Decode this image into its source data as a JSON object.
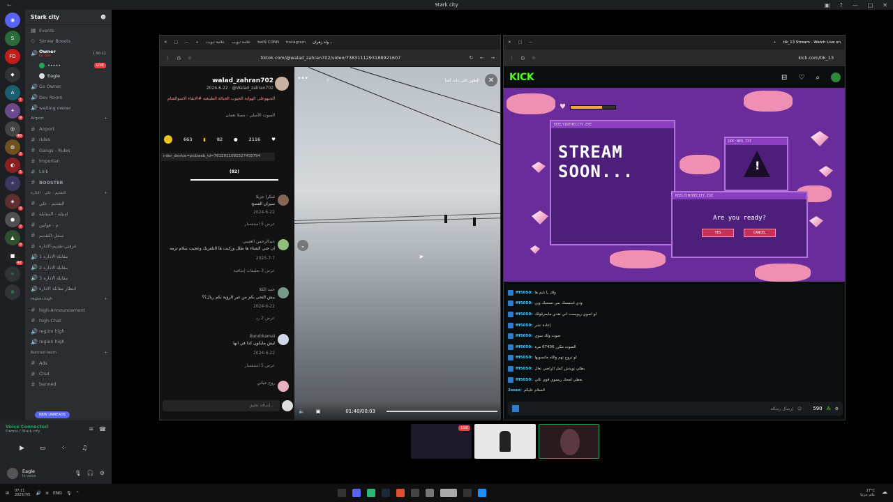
{
  "app": {
    "title": "Stark city"
  },
  "server": {
    "name": "Stark city"
  },
  "channels": {
    "top": [
      {
        "label": "Events"
      },
      {
        "label": "Server Boosts"
      }
    ],
    "owner_voice": {
      "label": "Owner",
      "sublabel": "Go Live",
      "timer": "1:50:11"
    },
    "owner_users": [
      {
        "name": "•••••",
        "live": "LIVE"
      },
      {
        "name": "Eagle",
        "live": ""
      }
    ],
    "items": [
      {
        "label": "Co Owner"
      },
      {
        "label": "Dev Room"
      },
      {
        "label": "waiting owner"
      }
    ],
    "cat_airport": "Airport",
    "airport": [
      {
        "label": "Airport"
      },
      {
        "label": "rules"
      },
      {
        "label": "Gangs - Rules"
      },
      {
        "label": "Importan"
      },
      {
        "label": "Link"
      },
      {
        "label": "BOOSTER"
      }
    ],
    "cat_arabic": "التقديم - علي - الادارة",
    "arabic": [
      {
        "label": "التقديم - علي"
      },
      {
        "label": "اسئلة - المقابلة"
      },
      {
        "label": "م - قوانين"
      },
      {
        "label": "سجل-التقديم"
      },
      {
        "label": "غرفتي-تقديم-الاداره"
      },
      {
        "label": "مقابلة-الاداره 1"
      },
      {
        "label": "مقابلة الاداره 2"
      },
      {
        "label": "مقابلة الاداره 3"
      },
      {
        "label": "انتظار مقابلة الادارة"
      }
    ],
    "cat_region": "region high",
    "region": [
      {
        "label": "high-Announcement"
      },
      {
        "label": "high-Chat"
      },
      {
        "label": "region high"
      },
      {
        "label": "region high"
      }
    ],
    "cat_banned": "Banned team",
    "banned": [
      {
        "label": "Ads"
      },
      {
        "label": "Chat"
      },
      {
        "label": "banned"
      }
    ],
    "new_unreads": "NEW UNREADS"
  },
  "voice": {
    "status": "Voice Connected",
    "location": "Owner / Stark city"
  },
  "user": {
    "name": "Eagle",
    "status": "In voice"
  },
  "left_browser": {
    "tabs": [
      "علامة تبويب",
      "علامة تبويب",
      "beIN CONN",
      "Instagram",
      "ولد زهران ..."
    ],
    "url": "tiktok.com/@walad_zahran702/video/7383111293188921607",
    "author": "walad_zahran702",
    "date_handle": "2024-6-22 · @Walad_zahran702",
    "caption": "الجبهوعلى الهواية الجبوب الجبالة الطبيعيه #الابقاء الاسوالشام",
    "sound": "الصوت الأصلي - مصلا نعمان",
    "stats": {
      "likes": "2116",
      "comments": "82",
      "saves": "663"
    },
    "link": "nder_device=pc&web_id=7612011091527435794",
    "comments_count": "(82)",
    "comments": [
      {
        "name": "شكرا جزيلا",
        "text": "سيزان الفصح",
        "date": "2024-6-22",
        "replies": "عرض 5 استفسار"
      },
      {
        "name": "عبدالرحمن العتيبي",
        "text": "ان جتي الشتاء ها طلل وركبت ها التلفريك وعجبت سلام ترمه",
        "date": "2025-7-7",
        "replies": "عرض 3 تعليقات إضافية"
      },
      {
        "name": "حمد الكلا",
        "text": "بيش التحى بكم من غير الرؤية بكم ريال؟؟",
        "date": "2024-6-22",
        "replies": "عرض 2 رد"
      },
      {
        "name": "Bandrkamal",
        "text": "ليش مايكون كذا في ابها",
        "date": "2024-6-22",
        "replies": "عرض 5 استفسار"
      },
      {
        "name": "روح حياتي",
        "text": "",
        "date": "",
        "replies": ""
      }
    ],
    "add_comment": "إضافة تعليق...",
    "video_overlay": "الطور على ذات اسا",
    "time": "01:40/00:03"
  },
  "right_browser": {
    "tab": "tik_13 Stream - Watch Live on",
    "url": "kick.com/tik_13",
    "logo": "KICK",
    "overlay": {
      "win1": "KEELYINTHECITY.EXE",
      "stream_text": "STREAM SOON...",
      "win2": "DOC_NEO.TXT",
      "win3": "KEELYINTHECITY.EXE",
      "question": "Are you ready?",
      "yes": "YES",
      "cancel": "CANCEL"
    },
    "chat": [
      {
        "user": "fff5050:",
        "text": "ولك يا نايم ها"
      },
      {
        "user": "fff5050:",
        "text": "ودي اسمسك بس تسحبك وين"
      },
      {
        "user": "fff5050:",
        "text": "لو اصوي ريويست اني نقدي مايمرقولك"
      },
      {
        "user": "fff5050:",
        "text": "إعادة نشر"
      },
      {
        "user": "fff5050:",
        "text": "صوت ولك سوي"
      },
      {
        "user": "fff5050:",
        "text": "الصوت مكرر 67436 مرة"
      },
      {
        "user": "fff5050:",
        "text": "لو تروح تهم والله ماتسويها"
      },
      {
        "user": "fff5050:",
        "text": "بطلي نويدش كمل الراضي تعال"
      },
      {
        "user": "fff5050:",
        "text": "بعطي امحك ريسوي قوي تالي"
      },
      {
        "user": "2ssax:",
        "text": "السلام عليكم"
      }
    ],
    "input_placeholder": "إرسال رسالة",
    "points": "590"
  },
  "taskbar": {
    "weather": "27°C",
    "weather_sub": "غائم جزئيا",
    "lang": "ENG",
    "time": "07:11",
    "date": "2025/7/5"
  }
}
